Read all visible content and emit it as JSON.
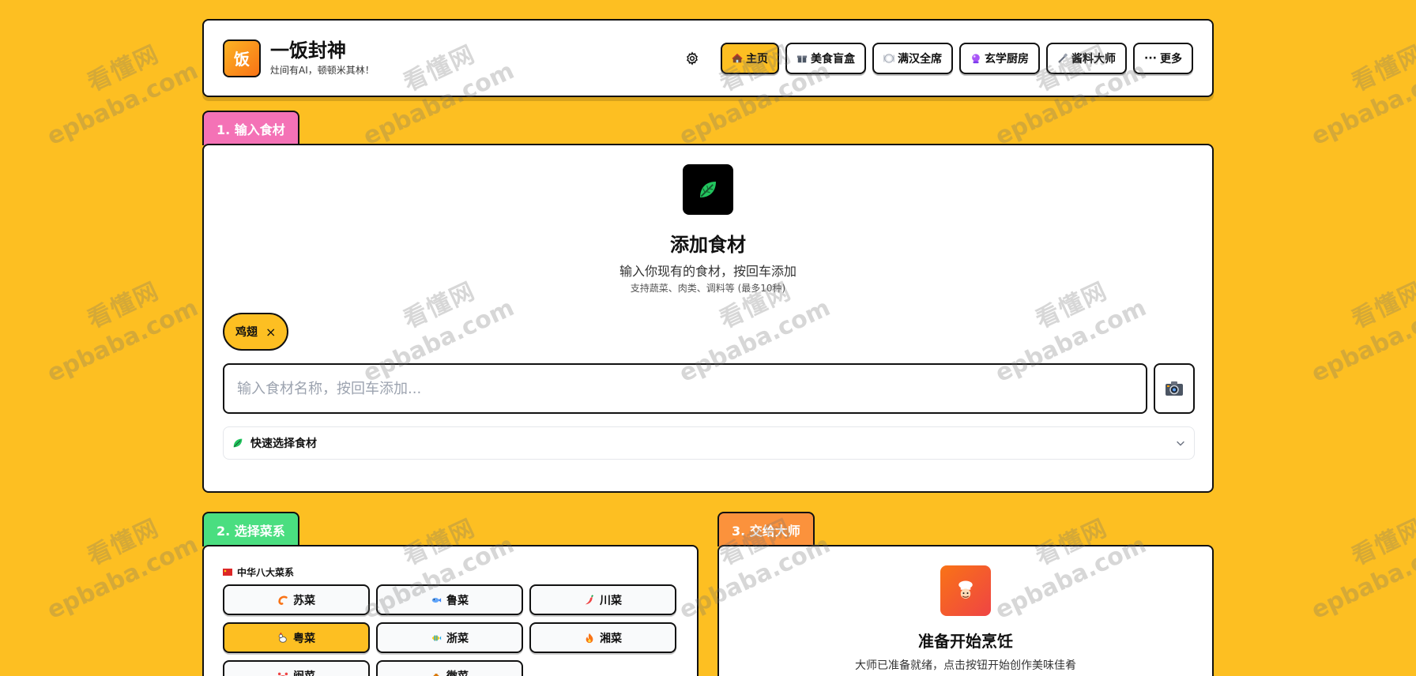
{
  "header": {
    "logo_char": "饭",
    "title": "一饭封神",
    "subtitle": "灶间有AI，顿顿米其林！",
    "nav": [
      {
        "icon": "house-icon",
        "label": "主页",
        "active": true
      },
      {
        "icon": "gift-box-icon",
        "label": "美食盲盒",
        "active": false
      },
      {
        "icon": "plate-icon",
        "label": "满汉全席",
        "active": false
      },
      {
        "icon": "crystal-ball-icon",
        "label": "玄学厨房",
        "active": false
      },
      {
        "icon": "sauce-icon",
        "label": "酱料大师",
        "active": false
      },
      {
        "icon": "more-icon",
        "label": "更多",
        "active": false
      }
    ],
    "more_glyph": "···"
  },
  "section1": {
    "tab": "1. 输入食材",
    "tab_color": "#F472B6",
    "title": "添加食材",
    "desc": "输入你现有的食材，按回车添加",
    "hint": "支持蔬菜、肉类、调料等 (最多10种)",
    "chips": [
      {
        "label": "鸡翅",
        "remove": "×"
      }
    ],
    "input_placeholder": "输入食材名称，按回车添加...",
    "input_value": "",
    "quick_label": "快速选择食材"
  },
  "section2": {
    "tab": "2. 选择菜系",
    "tab_color": "#4ADE80",
    "group_label": "中华八大菜系",
    "cuisines": [
      {
        "icon": "shrimp-icon",
        "label": "苏菜",
        "active": false
      },
      {
        "icon": "fish-icon",
        "label": "鲁菜",
        "active": false
      },
      {
        "icon": "chili-icon",
        "label": "川菜",
        "active": false
      },
      {
        "icon": "rooster-icon",
        "label": "粤菜",
        "active": true
      },
      {
        "icon": "tropical-fish-icon",
        "label": "浙菜",
        "active": false
      },
      {
        "icon": "fire-icon",
        "label": "湘菜",
        "active": false
      },
      {
        "icon": "crab-icon",
        "label": "闽菜",
        "active": false
      },
      {
        "icon": "ox-icon",
        "label": "徽菜",
        "active": false
      }
    ]
  },
  "section3": {
    "tab": "3. 交给大师",
    "tab_color": "#FB923C",
    "title": "准备开始烹饪",
    "desc": "大师已准备就绪，点击按钮开始创作美味佳肴"
  },
  "watermark": {
    "cn": "看懂网",
    "en": "epbaba.com"
  },
  "colors": {
    "background": "#FDBF22",
    "accent": "#FDBF22",
    "border": "#111111"
  }
}
